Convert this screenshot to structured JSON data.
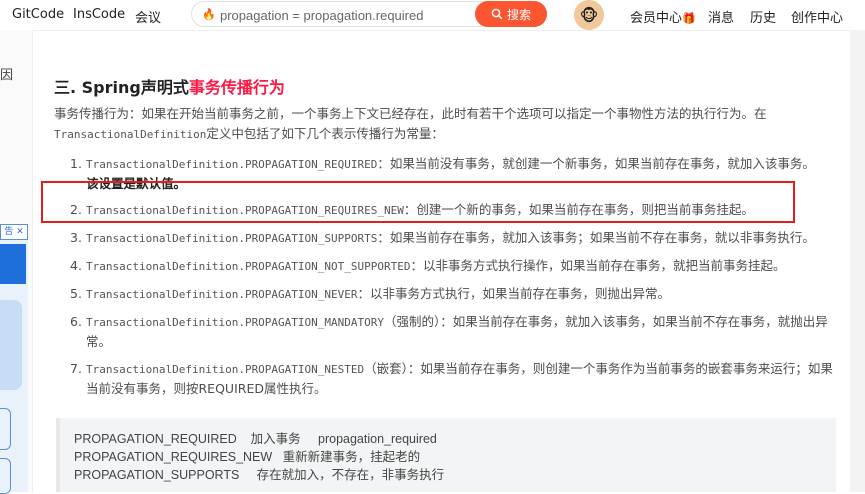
{
  "topbar": {
    "links": [
      "GitCode",
      "InsCode",
      "会议"
    ],
    "search_value": "propagation = propagation.required",
    "search_button": "搜索",
    "right_links": [
      "会员中心",
      "消息",
      "历史",
      "创作中心"
    ]
  },
  "sidebar": {
    "left_char": "因",
    "ad_close": "告 ✕"
  },
  "article": {
    "heading_prefix": "三. Spring声明式",
    "heading_highlight": "事务传播行为",
    "intro_1": "事务传播行为：如果在开始当前事务之前，一个事务上下文已经存在，此时有若干个选项可以指定一个事物性方法的执行行为。在",
    "intro_code": "TransactionalDefinition",
    "intro_2": "定义中包括了如下几个表示传播行为常量：",
    "items": [
      {
        "num": "1.",
        "code": "TransactionalDefinition.PROPAGATION_REQUIRED",
        "text": "：如果当前没有事务，就创建一个新事务，如果当前存在事务，就加入该事务。",
        "bold": "该设置是默认值。"
      },
      {
        "num": "2.",
        "code": "TransactionalDefinition.PROPAGATION_REQUIRES_NEW",
        "text": "：创建一个新的事务，如果当前存在事务，则把当前事务挂起。"
      },
      {
        "num": "3.",
        "code": "TransactionalDefinition.PROPAGATION_SUPPORTS",
        "text": "：如果当前存在事务，就加入该事务；如果当前不存在事务，就以非事务执行。"
      },
      {
        "num": "4.",
        "code": "TransactionalDefinition.PROPAGATION_NOT_SUPPORTED",
        "text": "：以非事务方式执行操作，如果当前存在事务，就把当前事务挂起。"
      },
      {
        "num": "5.",
        "code": "TransactionalDefinition.PROPAGATION_NEVER",
        "text": "：以非事务方式执行，如果当前存在事务，则抛出异常。"
      },
      {
        "num": "6.",
        "code": "TransactionalDefinition.PROPAGATION_MANDATORY",
        "text": "（强制的）：如果当前存在事务，就加入该事务，如果当前不存在事务，就抛出异常。"
      },
      {
        "num": "7.",
        "code": "TransactionalDefinition.PROPAGATION_NESTED",
        "text": "（嵌套）：如果当前存在事务，则创建一个事务作为当前事务的嵌套事务来运行；如果当前没有事务，则按REQUIRED属性执行。"
      }
    ],
    "code_lines": [
      "PROPAGATION_REQUIRED    加入事务     propagation_required",
      "PROPAGATION_REQUIRES_NEW   重新新建事务，挂起老的",
      "PROPAGATION_SUPPORTS     存在就加入，不存在，非事务执行"
    ]
  },
  "colors": {
    "accent": "#fc5531",
    "highlight": "#fc1944",
    "annotation": "#e02020"
  }
}
